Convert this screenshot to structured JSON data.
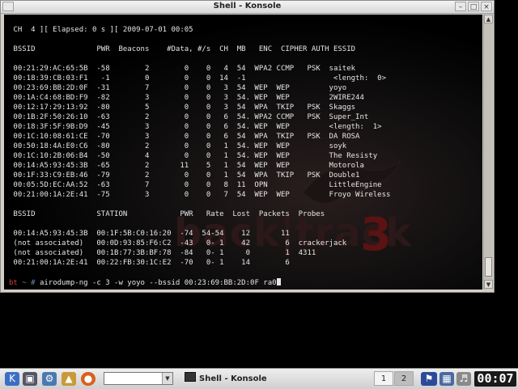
{
  "window": {
    "title": "Shell - Konsole"
  },
  "terminal": {
    "header": " CH  4 ][ Elapsed: 0 s ][ 2009-07-01 00:05",
    "ap_header": " BSSID              PWR  Beacons    #Data, #/s  CH  MB   ENC  CIPHER AUTH ESSID",
    "ap_rows": [
      " 00:21:29:AC:65:5B  -58        2        0    0   4  54  WPA2 CCMP   PSK  saitek",
      " 00:18:39:CB:03:F1   -1        0        0    0  14  -1                    <length:  0>",
      " 00:23:69:BB:2D:0F  -31        7        0    0   3  54  WEP  WEP         yoyo",
      " 00:1A:C4:68:BD:F9  -82        3        0    0   3  54. WEP  WEP         2WIRE244",
      " 00:12:17:29:13:92  -80        5        0    0   3  54  WPA  TKIP   PSK  Skaggs",
      " 00:1B:2F:50:26:10  -63        2        0    0   6  54. WPA2 CCMP   PSK  Super_Int",
      " 00:18:3F:5F:9B:D9  -45        3        0    0   6  54. WEP  WEP         <length:  1>",
      " 00:1C:10:08:61:CE  -70        3        0    0   6  54  WPA  TKIP   PSK  DA ROSA",
      " 00:50:18:4A:E0:C6  -80        2        0    0   1  54. WEP  WEP         soyk",
      " 00:1C:10:2B:06:B4  -50        4        0    0   1  54. WEP  WEP         The Resisty",
      " 00:14:A5:93:45:3B  -65        2       11    5   1  54  WEP  WEP         Motorola",
      " 00:1F:33:C9:EB:46  -79        2        0    0   1  54  WPA  TKIP   PSK  Double1",
      " 00:05:5D:EC:AA:52  -63        7        0    0   8  11  OPN              LittleEngine",
      " 00:21:00:1A:2E:41  -75        3        0    0   7  54  WEP  WEP         Froyo Wireless"
    ],
    "station_header": " BSSID              STATION            PWR   Rate  Lost  Packets  Probes",
    "station_rows": [
      " 00:14:A5:93:45:3B  00:1F:5B:C0:16:20  -74  54-54    12       11",
      " (not associated)   00:0D:93:85:F6:C2  -43   0- 1    42        6  crackerjack",
      " (not associated)   00:1B:77:3B:BF:78  -84   0- 1     0        1  4311",
      " 00:21:00:1A:2E:41  00:22:FB:30:1C:E2  -70   0- 1    14        6"
    ],
    "prompt_host": "bt",
    "prompt_tail": " ~ # ",
    "command": "airodump-ng -c 3 -w yoyo --bssid 00:23:69:BB:2D:0F ra0",
    "watermark": "back|track",
    "watermark_number": "3"
  },
  "taskbar": {
    "task_label": "Shell - Konsole",
    "pager": [
      "1",
      "2"
    ],
    "clock": "00:07",
    "icons": [
      "kde-menu-icon",
      "show-desktop-icon",
      "network-icon",
      "file-manager-icon",
      "firefox-icon"
    ]
  },
  "colors": {
    "prompt_host": "#e03a3a",
    "prompt_tail": "#6a8ab0",
    "terminal_text": "#e6e6e6"
  }
}
